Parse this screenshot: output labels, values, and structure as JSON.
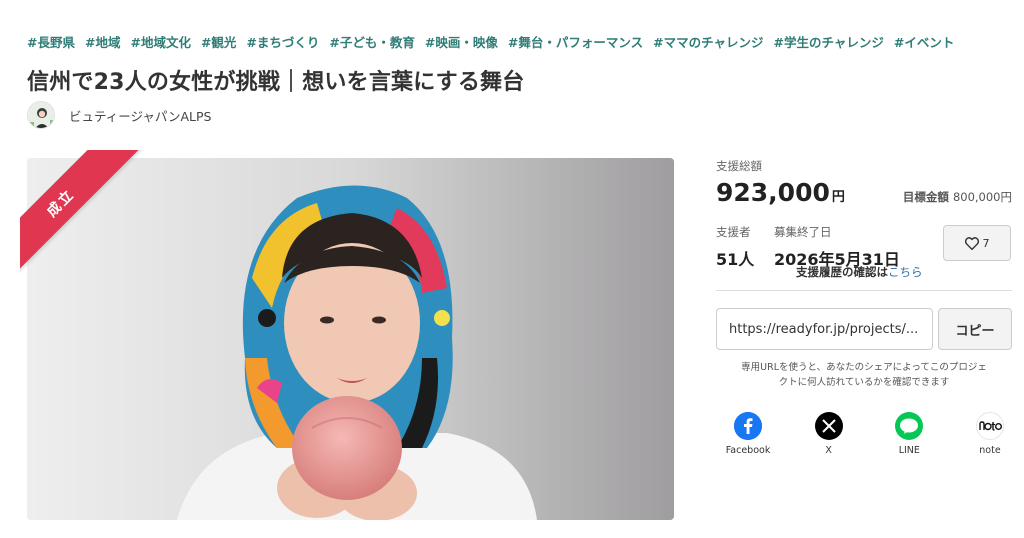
{
  "tags": [
    "#長野県",
    "#地域",
    "#地域文化",
    "#観光",
    "#まちづくり",
    "#子ども・教育",
    "#映画・映像",
    "#舞台・パフォーマンス",
    "#ママのチャレンジ",
    "#学生のチャレンジ",
    "#イベント"
  ],
  "project": {
    "title": "信州で23人の女性が挑戦｜想いを言葉にする舞台",
    "owner": "ビュティージャパンALPS",
    "status_ribbon": "成立"
  },
  "funding": {
    "total_label": "支援総額",
    "total_amount": "923,000",
    "currency": "円",
    "goal_label": "目標金額",
    "goal_amount": "800,000円",
    "supporters_label": "支援者",
    "supporters_value": "51人",
    "end_label": "募集終了日",
    "end_value": "2026年5月31日",
    "history_text": "支援履歴の確認は",
    "history_link": "こちら",
    "like_count": "7"
  },
  "share": {
    "url_value": "https://readyfor.jp/projects/...",
    "copy_label": "コピー",
    "note_line1": "専用URLを使うと、あなたのシェアによってこのプロジェ",
    "note_line2": "クトに何人訪れているかを確認できます",
    "items": [
      {
        "label": "Facebook",
        "icon": "facebook-icon",
        "color": "#1877f2"
      },
      {
        "label": "X",
        "icon": "x-icon",
        "color": "#000000"
      },
      {
        "label": "LINE",
        "icon": "line-icon",
        "color": "#06c755"
      },
      {
        "label": "note",
        "icon": "note-icon",
        "color": "#ffffff"
      }
    ]
  },
  "colors": {
    "tag": "#2f7d76",
    "ribbon": "#e0364f",
    "link": "#2f6fae"
  }
}
